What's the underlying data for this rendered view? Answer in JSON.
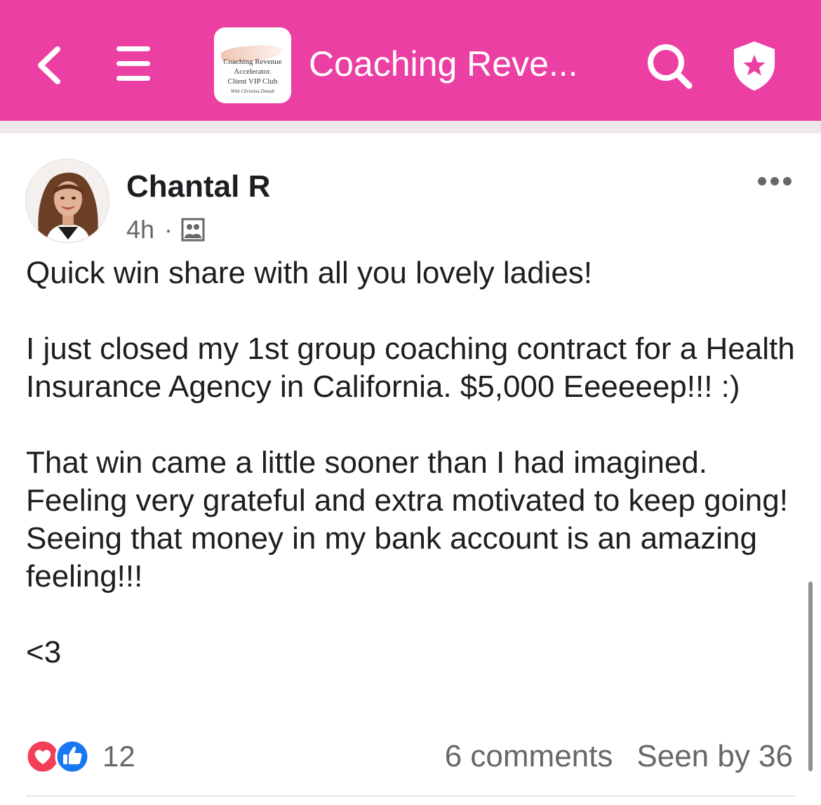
{
  "header": {
    "back_icon": "chevron-left-icon",
    "menu_icon": "hamburger-menu-icon",
    "group_logo": {
      "line1": "Coaching Revenue",
      "line2": "Accelerator.",
      "line3": "Client VIP Club",
      "line4": "With Christina Donali"
    },
    "group_title": "Coaching Reve...",
    "search_icon": "search-icon",
    "admin_icon": "shield-star-icon",
    "background_color": "#EC3FA4"
  },
  "post": {
    "author_name": "Chantal R",
    "time": "4h",
    "separator": "·",
    "audience_icon": "group-members-icon",
    "more_icon": "more-horizontal-icon",
    "body": {
      "p1": "Quick win share with all you lovely ladies!",
      "p2": "I just closed my 1st group coaching contract for a Health Insurance Agency in California. $5,000 Eeeeeep!!! :)",
      "p3": "That win came a little sooner than I had imagined. Feeling very grateful and extra motivated to keep going! Seeing that money in my bank account is an amazing feeling!!!",
      "p4": "<3"
    },
    "reactions": {
      "types": [
        "love",
        "like"
      ],
      "count": "12"
    },
    "comments": "6 comments",
    "seen_by": "Seen by 36"
  }
}
